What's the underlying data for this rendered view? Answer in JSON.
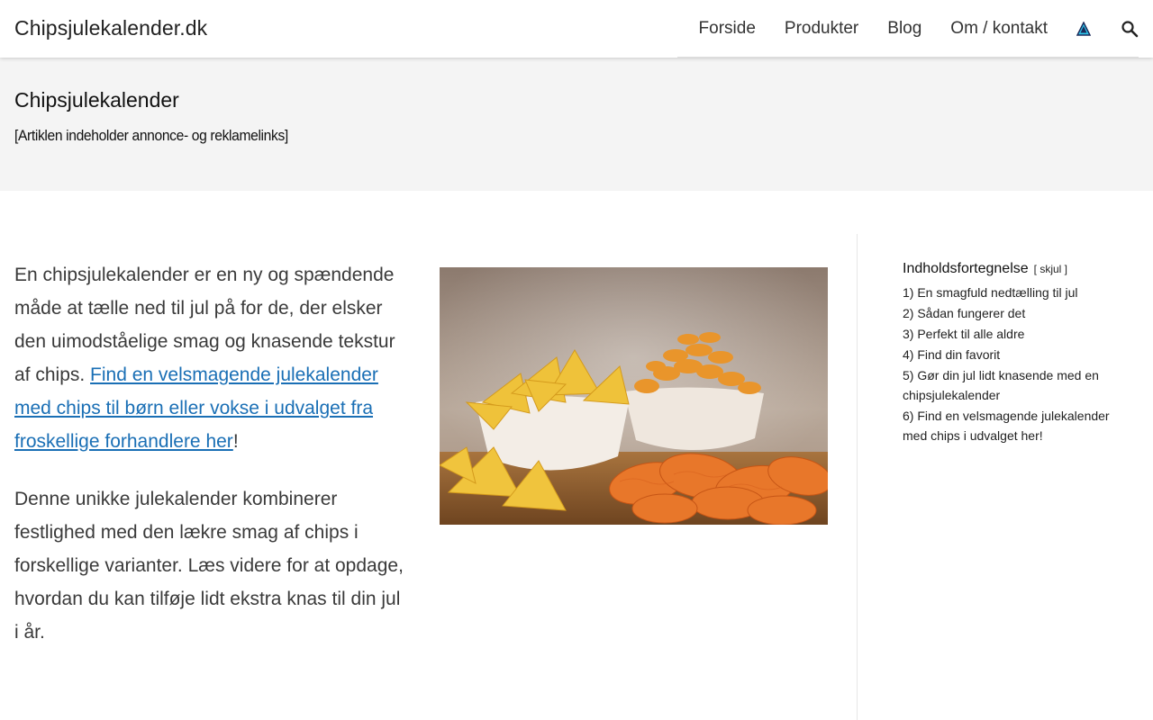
{
  "header": {
    "site_title": "Chipsjulekalender.dk",
    "nav": [
      "Forside",
      "Produkter",
      "Blog",
      "Om / kontakt"
    ]
  },
  "band": {
    "title": "Chipsjulekalender",
    "disclaimer": "[Artiklen indeholder annonce- og reklamelinks]"
  },
  "article": {
    "intro_text": "En chipsjulekalender er en ny og spændende måde at tælle ned til jul på for de, der elsker den uimodståelige smag og knasende tekstur af chips. ",
    "intro_link": "Find en velsmagende julekalender med chips til børn eller vokse i udvalget fra froskellige forhandlere her",
    "intro_end": "!",
    "para2": "Denne unikke julekalender kombinerer festlighed med den lækre smag af chips i forskellige varianter. Læs videre for at opdage, hvordan du kan tilføje lidt ekstra knas til din jul i år."
  },
  "toc": {
    "heading": "Indholdsfortegnelse",
    "toggle": "[ skjul ]",
    "items": [
      "1) En smagfuld nedtælling til jul",
      "2) Sådan fungerer det",
      "3) Perfekt til alle aldre",
      "4) Find din favorit",
      "5) Gør din jul lidt knasende med en chipsjulekalender",
      "6) Find en velsmagende julekalender med chips i udvalget her!"
    ]
  },
  "icons": {
    "nav_triangle": "warning-triangle-icon",
    "nav_search": "search-icon"
  },
  "colors": {
    "link": "#1a6fb5",
    "band_bg": "#f4f4f4"
  }
}
